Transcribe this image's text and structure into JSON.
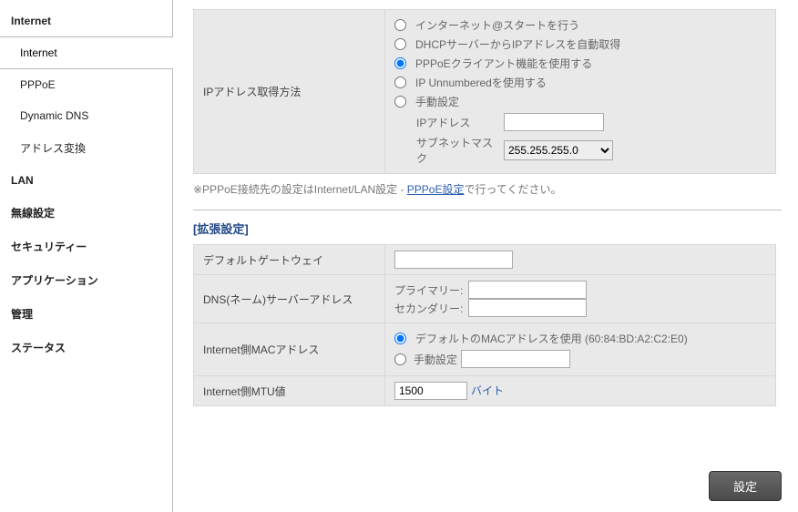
{
  "sidebar": {
    "sections": [
      {
        "title": "Internet",
        "items": [
          "Internet",
          "PPPoE",
          "Dynamic DNS",
          "アドレス変換"
        ],
        "activeIndex": 0
      },
      {
        "title": "LAN",
        "items": []
      },
      {
        "title": "無線設定",
        "items": []
      },
      {
        "title": "セキュリティー",
        "items": []
      },
      {
        "title": "アプリケーション",
        "items": []
      },
      {
        "title": "管理",
        "items": []
      },
      {
        "title": "ステータス",
        "items": []
      }
    ]
  },
  "ipMethod": {
    "label": "IPアドレス取得方法",
    "options": {
      "atstart": "インターネット@スタートを行う",
      "dhcp": "DHCPサーバーからIPアドレスを自動取得",
      "pppoe": "PPPoEクライアント機能を使用する",
      "unnumbered": "IP Unnumberedを使用する",
      "manual": "手動設定"
    },
    "selected": "pppoe",
    "manual": {
      "ip_label": "IPアドレス",
      "ip_value": "",
      "mask_label": "サブネットマスク",
      "mask_selected": "255.255.255.0"
    }
  },
  "note": {
    "prefix": "※PPPoE接続先の設定はInternet/LAN設定 - ",
    "link": "PPPoE設定",
    "suffix": "で行ってください。"
  },
  "ext": {
    "title": "[拡張設定]",
    "gateway": {
      "label": "デフォルトゲートウェイ",
      "value": ""
    },
    "dns": {
      "label": "DNS(ネーム)サーバーアドレス",
      "primary_label": "プライマリー:",
      "secondary_label": "セカンダリー:",
      "primary": "",
      "secondary": ""
    },
    "mac": {
      "label": "Internet側MACアドレス",
      "default_label": "デフォルトのMACアドレスを使用 (60:84:BD:A2:C2:E0)",
      "manual_label": "手動設定",
      "manual_value": "",
      "selected": "default"
    },
    "mtu": {
      "label": "Internet側MTU値",
      "value": "1500",
      "unit": "バイト"
    }
  },
  "footer": {
    "submit": "設定"
  }
}
